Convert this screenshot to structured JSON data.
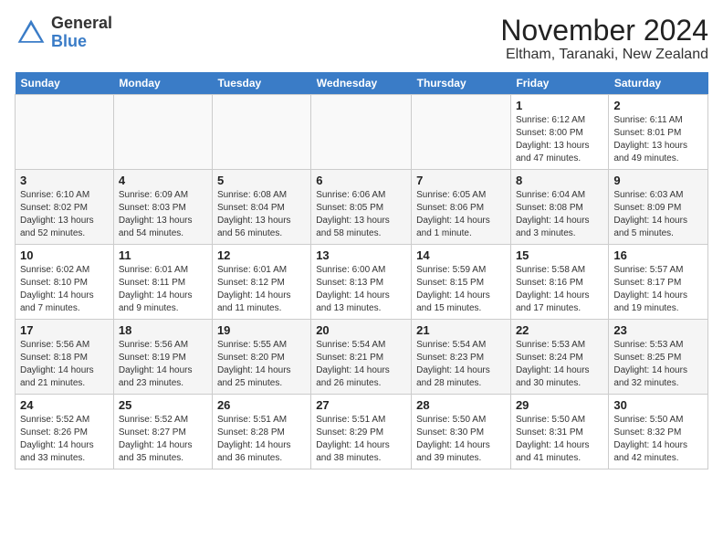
{
  "header": {
    "logo_line1": "General",
    "logo_line2": "Blue",
    "month": "November 2024",
    "location": "Eltham, Taranaki, New Zealand"
  },
  "days_of_week": [
    "Sunday",
    "Monday",
    "Tuesday",
    "Wednesday",
    "Thursday",
    "Friday",
    "Saturday"
  ],
  "weeks": [
    [
      {
        "day": "",
        "text": ""
      },
      {
        "day": "",
        "text": ""
      },
      {
        "day": "",
        "text": ""
      },
      {
        "day": "",
        "text": ""
      },
      {
        "day": "",
        "text": ""
      },
      {
        "day": "1",
        "text": "Sunrise: 6:12 AM\nSunset: 8:00 PM\nDaylight: 13 hours and 47 minutes."
      },
      {
        "day": "2",
        "text": "Sunrise: 6:11 AM\nSunset: 8:01 PM\nDaylight: 13 hours and 49 minutes."
      }
    ],
    [
      {
        "day": "3",
        "text": "Sunrise: 6:10 AM\nSunset: 8:02 PM\nDaylight: 13 hours and 52 minutes."
      },
      {
        "day": "4",
        "text": "Sunrise: 6:09 AM\nSunset: 8:03 PM\nDaylight: 13 hours and 54 minutes."
      },
      {
        "day": "5",
        "text": "Sunrise: 6:08 AM\nSunset: 8:04 PM\nDaylight: 13 hours and 56 minutes."
      },
      {
        "day": "6",
        "text": "Sunrise: 6:06 AM\nSunset: 8:05 PM\nDaylight: 13 hours and 58 minutes."
      },
      {
        "day": "7",
        "text": "Sunrise: 6:05 AM\nSunset: 8:06 PM\nDaylight: 14 hours and 1 minute."
      },
      {
        "day": "8",
        "text": "Sunrise: 6:04 AM\nSunset: 8:08 PM\nDaylight: 14 hours and 3 minutes."
      },
      {
        "day": "9",
        "text": "Sunrise: 6:03 AM\nSunset: 8:09 PM\nDaylight: 14 hours and 5 minutes."
      }
    ],
    [
      {
        "day": "10",
        "text": "Sunrise: 6:02 AM\nSunset: 8:10 PM\nDaylight: 14 hours and 7 minutes."
      },
      {
        "day": "11",
        "text": "Sunrise: 6:01 AM\nSunset: 8:11 PM\nDaylight: 14 hours and 9 minutes."
      },
      {
        "day": "12",
        "text": "Sunrise: 6:01 AM\nSunset: 8:12 PM\nDaylight: 14 hours and 11 minutes."
      },
      {
        "day": "13",
        "text": "Sunrise: 6:00 AM\nSunset: 8:13 PM\nDaylight: 14 hours and 13 minutes."
      },
      {
        "day": "14",
        "text": "Sunrise: 5:59 AM\nSunset: 8:15 PM\nDaylight: 14 hours and 15 minutes."
      },
      {
        "day": "15",
        "text": "Sunrise: 5:58 AM\nSunset: 8:16 PM\nDaylight: 14 hours and 17 minutes."
      },
      {
        "day": "16",
        "text": "Sunrise: 5:57 AM\nSunset: 8:17 PM\nDaylight: 14 hours and 19 minutes."
      }
    ],
    [
      {
        "day": "17",
        "text": "Sunrise: 5:56 AM\nSunset: 8:18 PM\nDaylight: 14 hours and 21 minutes."
      },
      {
        "day": "18",
        "text": "Sunrise: 5:56 AM\nSunset: 8:19 PM\nDaylight: 14 hours and 23 minutes."
      },
      {
        "day": "19",
        "text": "Sunrise: 5:55 AM\nSunset: 8:20 PM\nDaylight: 14 hours and 25 minutes."
      },
      {
        "day": "20",
        "text": "Sunrise: 5:54 AM\nSunset: 8:21 PM\nDaylight: 14 hours and 26 minutes."
      },
      {
        "day": "21",
        "text": "Sunrise: 5:54 AM\nSunset: 8:23 PM\nDaylight: 14 hours and 28 minutes."
      },
      {
        "day": "22",
        "text": "Sunrise: 5:53 AM\nSunset: 8:24 PM\nDaylight: 14 hours and 30 minutes."
      },
      {
        "day": "23",
        "text": "Sunrise: 5:53 AM\nSunset: 8:25 PM\nDaylight: 14 hours and 32 minutes."
      }
    ],
    [
      {
        "day": "24",
        "text": "Sunrise: 5:52 AM\nSunset: 8:26 PM\nDaylight: 14 hours and 33 minutes."
      },
      {
        "day": "25",
        "text": "Sunrise: 5:52 AM\nSunset: 8:27 PM\nDaylight: 14 hours and 35 minutes."
      },
      {
        "day": "26",
        "text": "Sunrise: 5:51 AM\nSunset: 8:28 PM\nDaylight: 14 hours and 36 minutes."
      },
      {
        "day": "27",
        "text": "Sunrise: 5:51 AM\nSunset: 8:29 PM\nDaylight: 14 hours and 38 minutes."
      },
      {
        "day": "28",
        "text": "Sunrise: 5:50 AM\nSunset: 8:30 PM\nDaylight: 14 hours and 39 minutes."
      },
      {
        "day": "29",
        "text": "Sunrise: 5:50 AM\nSunset: 8:31 PM\nDaylight: 14 hours and 41 minutes."
      },
      {
        "day": "30",
        "text": "Sunrise: 5:50 AM\nSunset: 8:32 PM\nDaylight: 14 hours and 42 minutes."
      }
    ]
  ]
}
